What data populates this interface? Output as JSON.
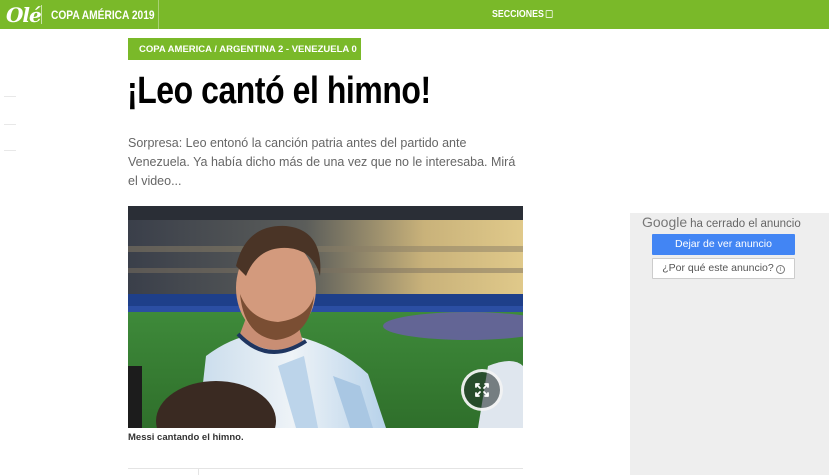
{
  "header": {
    "logo": "Olé",
    "section_title": "COPA AMÉRICA 2019",
    "sections_label": "SECCIONES"
  },
  "article": {
    "breadcrumb": "COPA AMERICA / ARGENTINA 2 - VENEZUELA 0",
    "headline": "¡Leo cantó el himno!",
    "summary": "Sorpresa: Leo entonó la canción patria antes del partido ante Venezuela. Ya había dicho más de una vez que no le interesaba. Mirá el video...",
    "image_caption": "Messi cantando el himno.",
    "image_icon": "expand-icon"
  },
  "ad": {
    "google_label": "Google",
    "closed_text": "ha cerrado el anuncio",
    "stop_button": "Dejar de ver anuncio",
    "why_button": "¿Por qué este anuncio?"
  },
  "colors": {
    "brand_green": "#7ab929",
    "ad_button_blue": "#4285f4"
  }
}
